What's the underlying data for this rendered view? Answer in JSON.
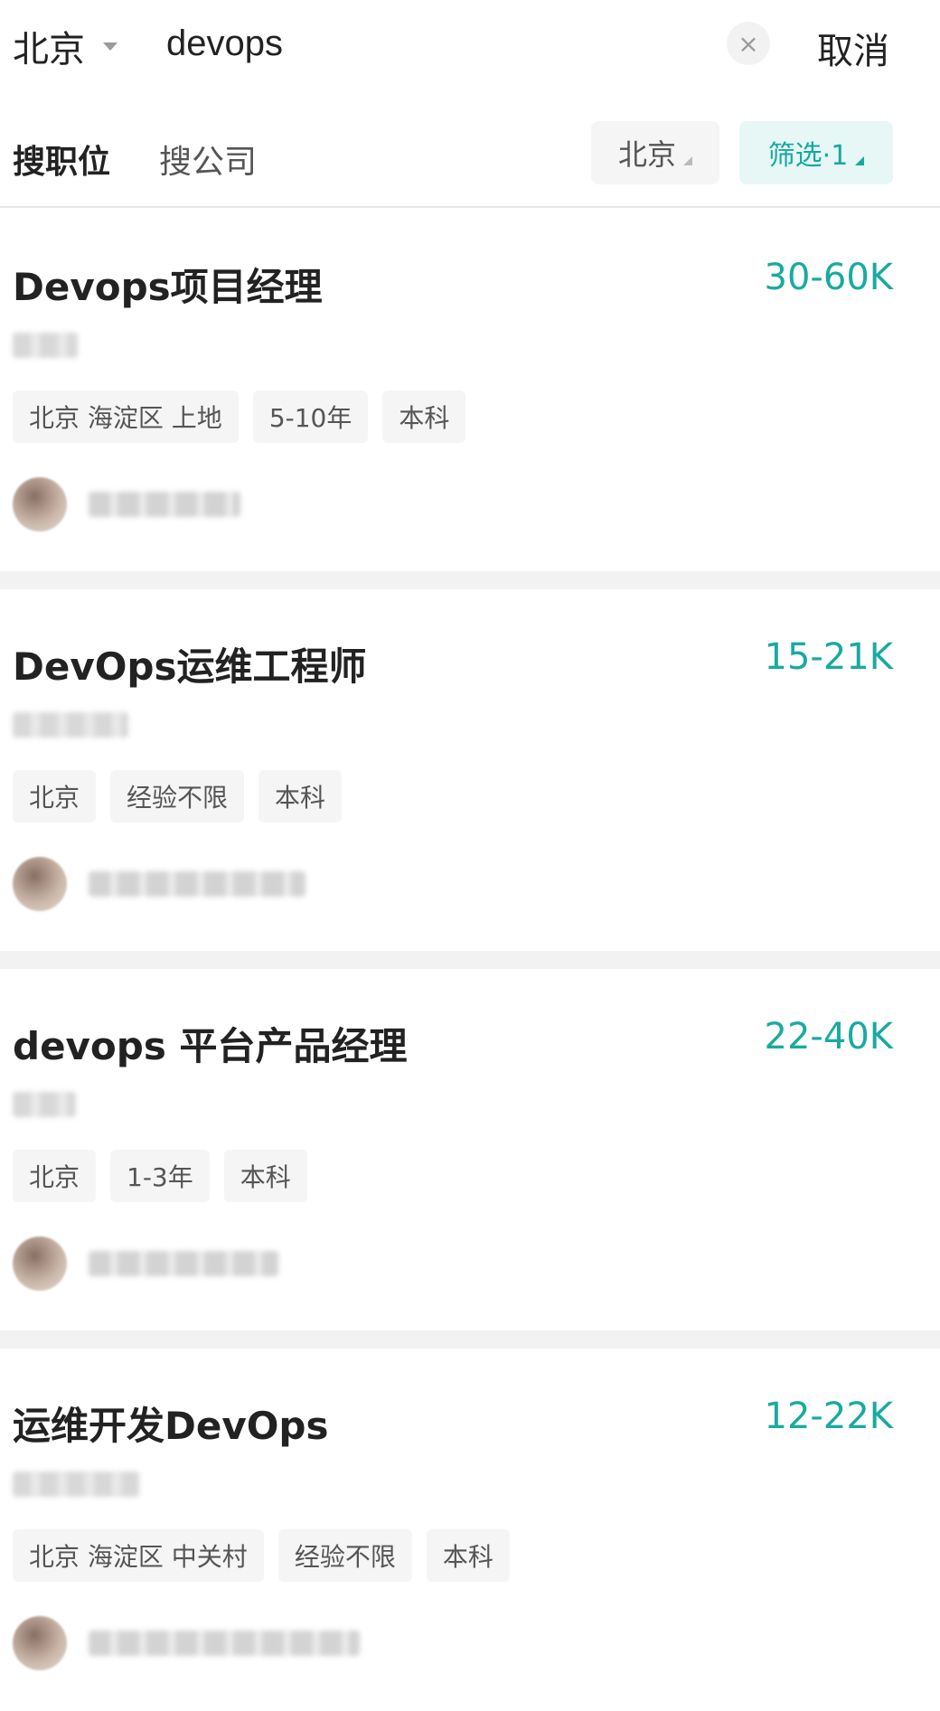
{
  "search": {
    "city": "北京",
    "query": "devops",
    "clear_icon": "×",
    "cancel_label": "取消"
  },
  "filter_bar": {
    "tab_jobs": "搜职位",
    "tab_companies": "搜公司",
    "city_pill": "北京",
    "filter_pill": "筛选·1",
    "accent_color": "#19aaa0"
  },
  "jobs": [
    {
      "title": "Devops项目经理",
      "salary": "30-60K",
      "tags": [
        "北京 海淀区 上地",
        "5-10年",
        "本科"
      ]
    },
    {
      "title": "DevOps运维工程师",
      "salary": "15-21K",
      "tags": [
        "北京",
        "经验不限",
        "本科"
      ]
    },
    {
      "title": "devops 平台产品经理",
      "salary": "22-40K",
      "tags": [
        "北京",
        "1-3年",
        "本科"
      ]
    },
    {
      "title": "运维开发DevOps",
      "salary": "12-22K",
      "tags": [
        "北京 海淀区 中关村",
        "经验不限",
        "本科"
      ]
    }
  ]
}
